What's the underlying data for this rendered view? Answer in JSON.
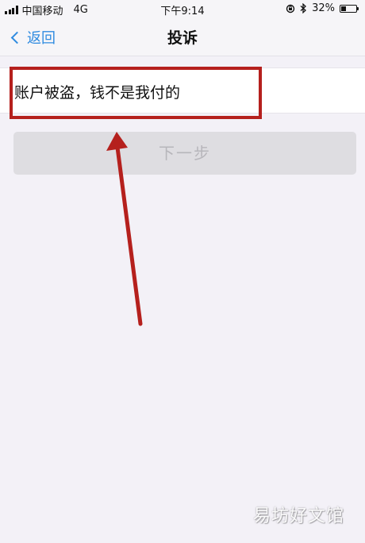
{
  "status_bar": {
    "carrier": "中国移动",
    "network": "4G",
    "time": "下午9:14",
    "battery": "32%",
    "battery_level": 0.32
  },
  "nav": {
    "back_label": "返回",
    "title": "投诉"
  },
  "option": {
    "label": "账户被盗，钱不是我付的"
  },
  "next_button": {
    "label": "下一步"
  },
  "annotation": {
    "box_color": "#b5201d",
    "arrow_color": "#b5201d"
  },
  "watermark": "易坊好文馆"
}
